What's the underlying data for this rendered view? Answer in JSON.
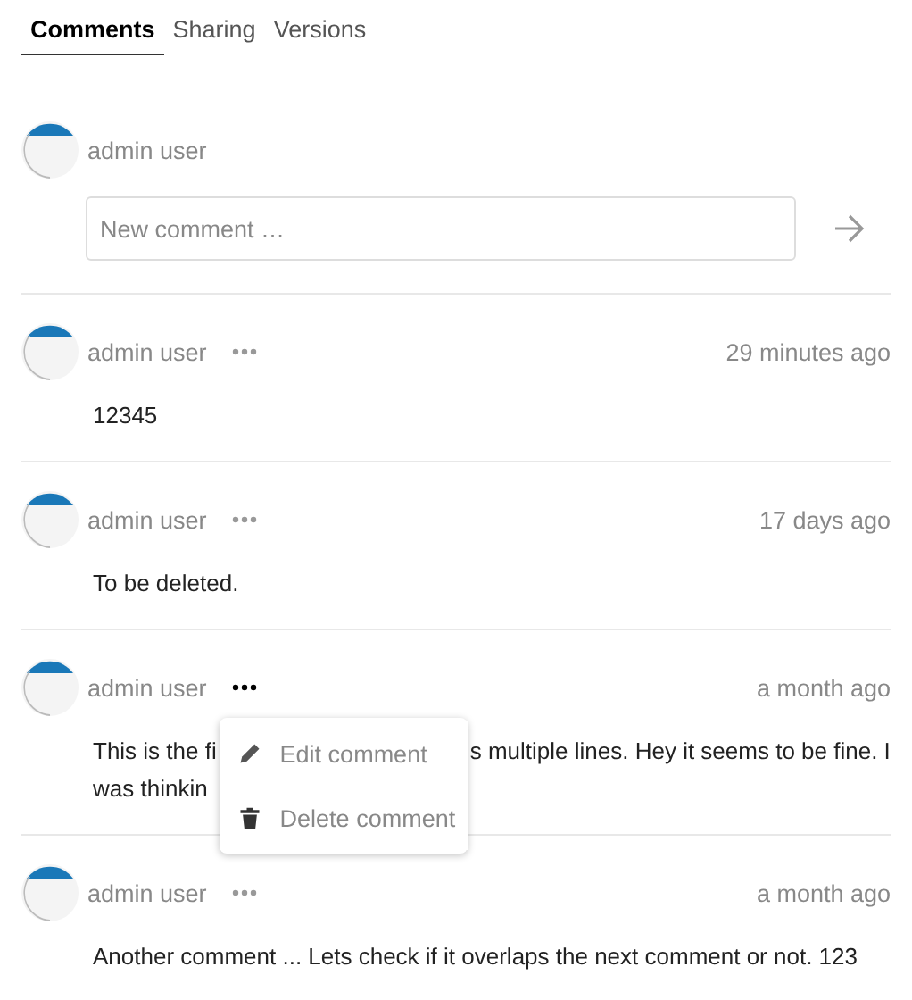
{
  "tabs": [
    {
      "label": "Comments",
      "selected": true
    },
    {
      "label": "Sharing",
      "selected": false
    },
    {
      "label": "Versions",
      "selected": false
    }
  ],
  "new_comment": {
    "author": "admin user",
    "placeholder": "New comment …"
  },
  "comments": [
    {
      "author": "admin user",
      "time": "29 minutes ago",
      "menu_open": false,
      "lines": [
        [
          "12345"
        ]
      ]
    },
    {
      "author": "admin user",
      "time": "17 days ago",
      "menu_open": false,
      "lines": [
        [
          "To be deleted."
        ]
      ]
    },
    {
      "author": "admin user",
      "time": "a month ago",
      "menu_open": true,
      "lines": [
        [
          "This is the fi",
          "s multiple lines. Hey it seems to be fine. I"
        ],
        [
          "was thinkin"
        ]
      ],
      "menu": [
        {
          "kind": "edit",
          "label": "Edit comment"
        },
        {
          "kind": "delete",
          "label": "Delete comment"
        }
      ]
    },
    {
      "author": "admin user",
      "time": "a month ago",
      "menu_open": false,
      "lines": [
        [
          "Another comment ... Lets check if it overlaps the next comment or not. 123"
        ]
      ]
    }
  ]
}
